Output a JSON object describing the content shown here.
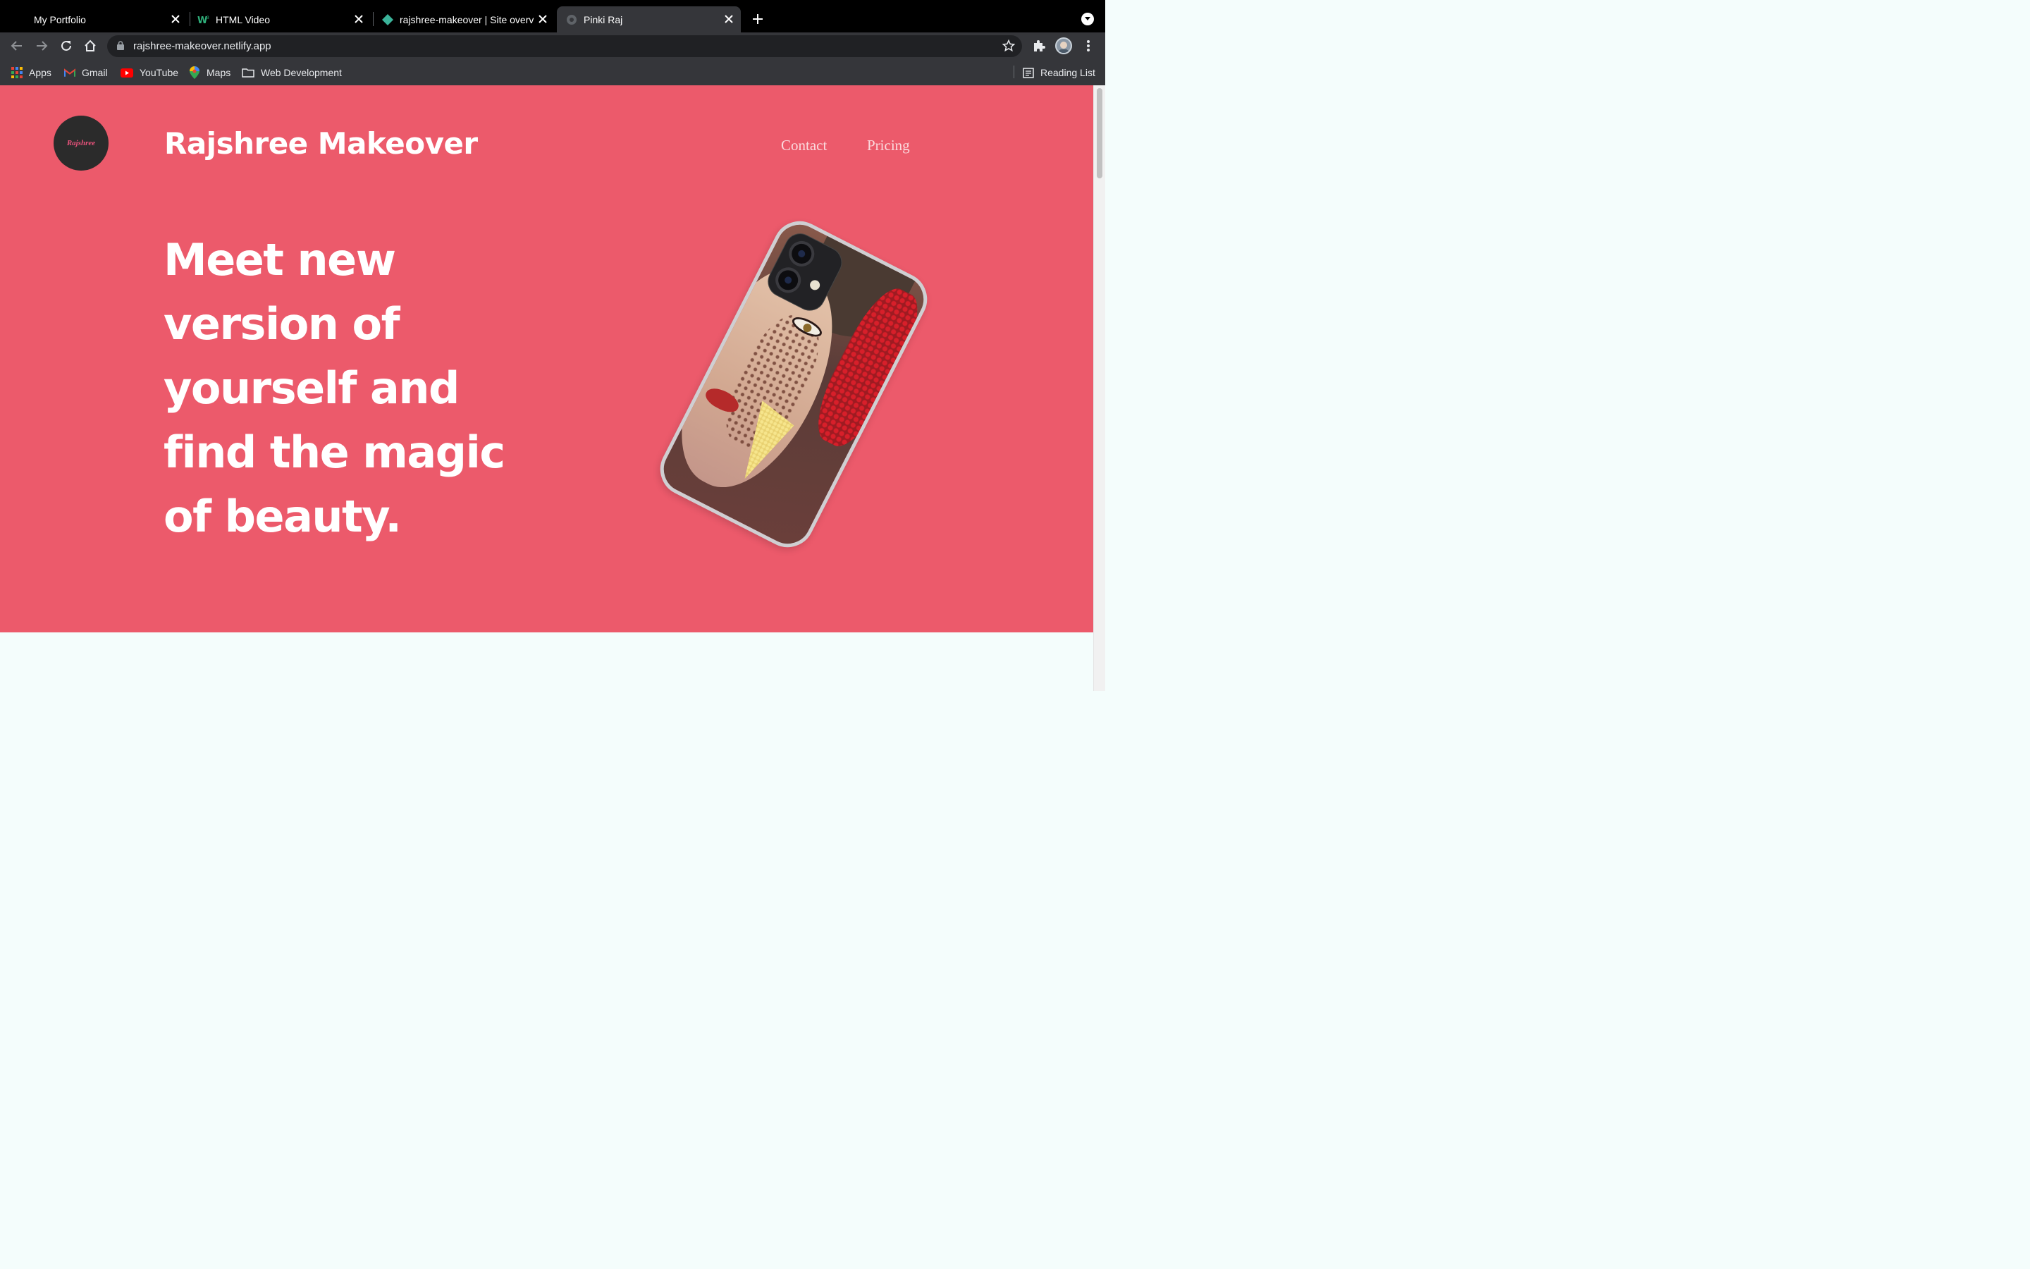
{
  "browser": {
    "tabs": [
      {
        "title": "My Portfolio",
        "icon": "none",
        "active": false
      },
      {
        "title": "HTML Video",
        "icon": "w3schools-icon",
        "active": false
      },
      {
        "title": "rajshree-makeover | Site overview",
        "icon": "netlify-icon",
        "active": false
      },
      {
        "title": "Pinki Raj",
        "icon": "globe-icon",
        "active": true
      }
    ],
    "url": "rajshree-makeover.netlify.app",
    "bookmarks": [
      {
        "label": "Apps",
        "icon": "apps-grid-icon"
      },
      {
        "label": "Gmail",
        "icon": "gmail-icon"
      },
      {
        "label": "YouTube",
        "icon": "youtube-icon"
      },
      {
        "label": "Maps",
        "icon": "maps-icon"
      },
      {
        "label": "Web Development",
        "icon": "folder-icon"
      }
    ],
    "reading_list": "Reading List"
  },
  "page": {
    "logo_text": "Rajshree",
    "site_title": "Rajshree Makeover",
    "nav": {
      "contact": "Contact",
      "pricing": "Pricing"
    },
    "headline_lines": [
      "Meet new",
      "version of",
      "yourself and",
      "find the magic",
      "of beauty."
    ],
    "colors": {
      "hero_bg": "#ec5a6b",
      "section_bg": "#f4fdfc",
      "nav_link": "#fbd9dd"
    }
  }
}
